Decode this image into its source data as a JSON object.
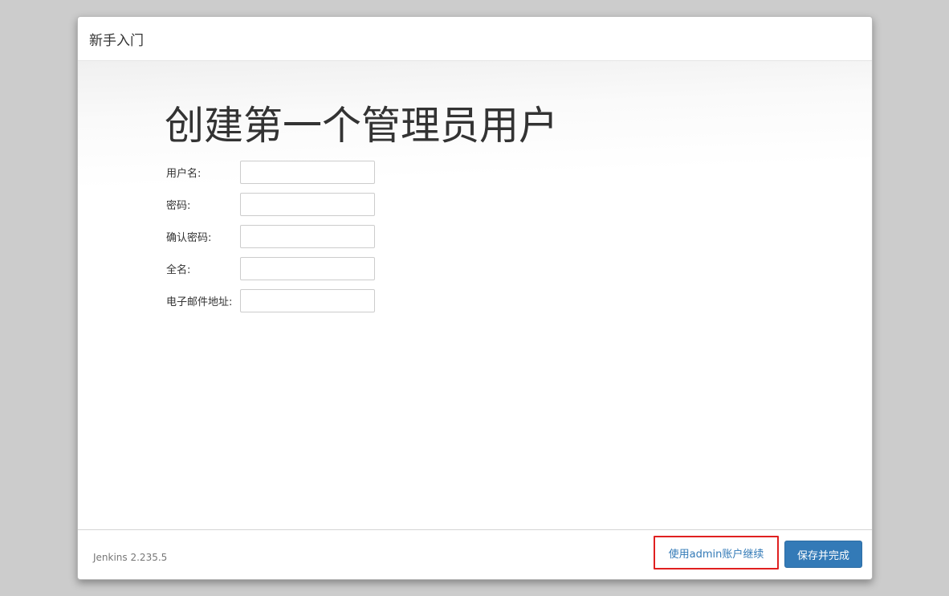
{
  "header": {
    "title": "新手入门"
  },
  "main": {
    "title": "创建第一个管理员用户",
    "fields": [
      {
        "label": "用户名:",
        "value": ""
      },
      {
        "label": "密码:",
        "value": ""
      },
      {
        "label": "确认密码:",
        "value": ""
      },
      {
        "label": "全名:",
        "value": ""
      },
      {
        "label": "电子邮件地址:",
        "value": ""
      }
    ]
  },
  "footer": {
    "version": "Jenkins 2.235.5",
    "continue_as_admin_label": "使用admin账户继续",
    "save_label": "保存并完成"
  },
  "colors": {
    "primary": "#337ab7",
    "highlight_box": "#e02020",
    "background": "#cccccc"
  }
}
